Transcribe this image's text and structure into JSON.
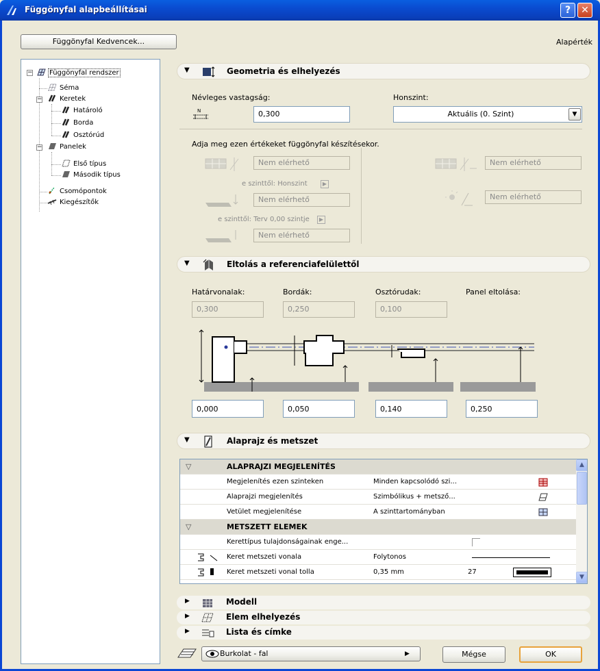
{
  "window": {
    "title": "Függönyfal alapbeállításai",
    "help_label": "?",
    "close_label": "✕"
  },
  "top": {
    "favorites_label": "Függönyfal Kedvencek...",
    "defaults_label": "Alapérték"
  },
  "tree": {
    "root": "Függönyfal rendszer",
    "schema": "Séma",
    "frames": "Keretek",
    "frame_boundary": "Határoló",
    "frame_mullion": "Borda",
    "frame_transom": "Osztórúd",
    "panels": "Panelek",
    "panel_first": "Első típus",
    "panel_second": "Második típus",
    "junctions": "Csomópontok",
    "accessories": "Kiegészítők"
  },
  "geometry": {
    "title": "Geometria és elhelyezés",
    "thickness_label": "Névleges vastagság:",
    "thickness_value": "0,300",
    "story_label": "Honszint:",
    "story_value": "Aktuális (0. Szint)",
    "hint": "Adja meg ezen értékeket függönyfal készítésekor.",
    "na1": "Nem elérhető",
    "na2": "Nem elérhető",
    "na3": "Nem elérhető",
    "na4": "Nem elérhető",
    "na5": "Nem elérhető",
    "from_story": "e szinttől: Honszint",
    "from_project": "e szinttől: Terv 0,00 szintje"
  },
  "offset": {
    "title": "Eltolás a referenciafelülettől",
    "boundary_label": "Határvonalak:",
    "mullion_label": "Bordák:",
    "transom_label": "Osztórudak:",
    "panel_label": "Panel eltolása:",
    "boundary_value": "0,300",
    "mullion_value": "0,250",
    "transom_value": "0,100",
    "off1": "0,000",
    "off2": "0,050",
    "off3": "0,140",
    "off4": "0,250"
  },
  "plan": {
    "title": "Alaprajz és metszet",
    "group1": "ALAPRAJZI MEGJELENÍTÉS",
    "group2": "METSZETT ELEMEK",
    "rows": [
      {
        "label": "Megjelenítés ezen szinteken",
        "value": "Minden kapcsolódó szi..."
      },
      {
        "label": "Alaprajzi megjelenítés",
        "value": "Szimbólikus + metsző..."
      },
      {
        "label": "Vetület megjelenítése",
        "value": "A szinttartományban"
      },
      {
        "label": "Kerettípus tulajdonságainak enge...",
        "value": ""
      },
      {
        "label": "Keret metszeti vonala",
        "value": "Folytonos"
      },
      {
        "label": "Keret metszeti vonal tolla",
        "value": "0,35 mm",
        "extra": "27"
      }
    ]
  },
  "sections": {
    "model": "Modell",
    "placement": "Elem elhelyezés",
    "list": "Lista és címke"
  },
  "bottom": {
    "layer": "Burkolat - fal",
    "cancel": "Mégse",
    "ok": "OK"
  },
  "colors": {
    "titlebar": "#0a4bd0",
    "accent": "#0b47d4",
    "ok_border": "#e8a23a"
  }
}
